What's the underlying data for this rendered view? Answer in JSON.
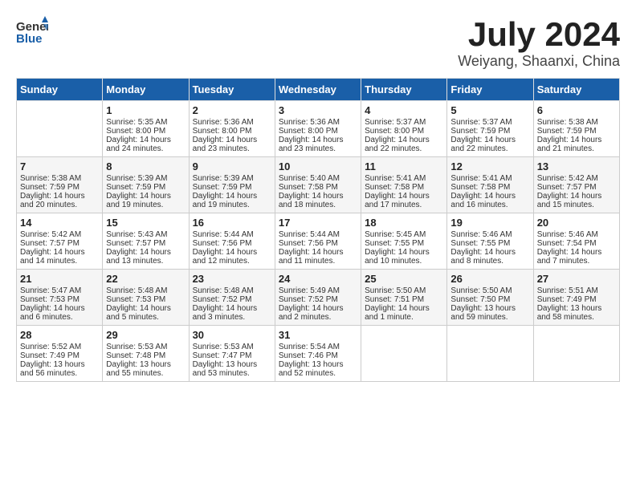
{
  "header": {
    "logo_general": "General",
    "logo_blue": "Blue",
    "month": "July 2024",
    "location": "Weiyang, Shaanxi, China"
  },
  "weekdays": [
    "Sunday",
    "Monday",
    "Tuesday",
    "Wednesday",
    "Thursday",
    "Friday",
    "Saturday"
  ],
  "weeks": [
    [
      {
        "day": "",
        "lines": []
      },
      {
        "day": "1",
        "lines": [
          "Sunrise: 5:35 AM",
          "Sunset: 8:00 PM",
          "Daylight: 14 hours",
          "and 24 minutes."
        ]
      },
      {
        "day": "2",
        "lines": [
          "Sunrise: 5:36 AM",
          "Sunset: 8:00 PM",
          "Daylight: 14 hours",
          "and 23 minutes."
        ]
      },
      {
        "day": "3",
        "lines": [
          "Sunrise: 5:36 AM",
          "Sunset: 8:00 PM",
          "Daylight: 14 hours",
          "and 23 minutes."
        ]
      },
      {
        "day": "4",
        "lines": [
          "Sunrise: 5:37 AM",
          "Sunset: 8:00 PM",
          "Daylight: 14 hours",
          "and 22 minutes."
        ]
      },
      {
        "day": "5",
        "lines": [
          "Sunrise: 5:37 AM",
          "Sunset: 7:59 PM",
          "Daylight: 14 hours",
          "and 22 minutes."
        ]
      },
      {
        "day": "6",
        "lines": [
          "Sunrise: 5:38 AM",
          "Sunset: 7:59 PM",
          "Daylight: 14 hours",
          "and 21 minutes."
        ]
      }
    ],
    [
      {
        "day": "7",
        "lines": [
          "Sunrise: 5:38 AM",
          "Sunset: 7:59 PM",
          "Daylight: 14 hours",
          "and 20 minutes."
        ]
      },
      {
        "day": "8",
        "lines": [
          "Sunrise: 5:39 AM",
          "Sunset: 7:59 PM",
          "Daylight: 14 hours",
          "and 19 minutes."
        ]
      },
      {
        "day": "9",
        "lines": [
          "Sunrise: 5:39 AM",
          "Sunset: 7:59 PM",
          "Daylight: 14 hours",
          "and 19 minutes."
        ]
      },
      {
        "day": "10",
        "lines": [
          "Sunrise: 5:40 AM",
          "Sunset: 7:58 PM",
          "Daylight: 14 hours",
          "and 18 minutes."
        ]
      },
      {
        "day": "11",
        "lines": [
          "Sunrise: 5:41 AM",
          "Sunset: 7:58 PM",
          "Daylight: 14 hours",
          "and 17 minutes."
        ]
      },
      {
        "day": "12",
        "lines": [
          "Sunrise: 5:41 AM",
          "Sunset: 7:58 PM",
          "Daylight: 14 hours",
          "and 16 minutes."
        ]
      },
      {
        "day": "13",
        "lines": [
          "Sunrise: 5:42 AM",
          "Sunset: 7:57 PM",
          "Daylight: 14 hours",
          "and 15 minutes."
        ]
      }
    ],
    [
      {
        "day": "14",
        "lines": [
          "Sunrise: 5:42 AM",
          "Sunset: 7:57 PM",
          "Daylight: 14 hours",
          "and 14 minutes."
        ]
      },
      {
        "day": "15",
        "lines": [
          "Sunrise: 5:43 AM",
          "Sunset: 7:57 PM",
          "Daylight: 14 hours",
          "and 13 minutes."
        ]
      },
      {
        "day": "16",
        "lines": [
          "Sunrise: 5:44 AM",
          "Sunset: 7:56 PM",
          "Daylight: 14 hours",
          "and 12 minutes."
        ]
      },
      {
        "day": "17",
        "lines": [
          "Sunrise: 5:44 AM",
          "Sunset: 7:56 PM",
          "Daylight: 14 hours",
          "and 11 minutes."
        ]
      },
      {
        "day": "18",
        "lines": [
          "Sunrise: 5:45 AM",
          "Sunset: 7:55 PM",
          "Daylight: 14 hours",
          "and 10 minutes."
        ]
      },
      {
        "day": "19",
        "lines": [
          "Sunrise: 5:46 AM",
          "Sunset: 7:55 PM",
          "Daylight: 14 hours",
          "and 8 minutes."
        ]
      },
      {
        "day": "20",
        "lines": [
          "Sunrise: 5:46 AM",
          "Sunset: 7:54 PM",
          "Daylight: 14 hours",
          "and 7 minutes."
        ]
      }
    ],
    [
      {
        "day": "21",
        "lines": [
          "Sunrise: 5:47 AM",
          "Sunset: 7:53 PM",
          "Daylight: 14 hours",
          "and 6 minutes."
        ]
      },
      {
        "day": "22",
        "lines": [
          "Sunrise: 5:48 AM",
          "Sunset: 7:53 PM",
          "Daylight: 14 hours",
          "and 5 minutes."
        ]
      },
      {
        "day": "23",
        "lines": [
          "Sunrise: 5:48 AM",
          "Sunset: 7:52 PM",
          "Daylight: 14 hours",
          "and 3 minutes."
        ]
      },
      {
        "day": "24",
        "lines": [
          "Sunrise: 5:49 AM",
          "Sunset: 7:52 PM",
          "Daylight: 14 hours",
          "and 2 minutes."
        ]
      },
      {
        "day": "25",
        "lines": [
          "Sunrise: 5:50 AM",
          "Sunset: 7:51 PM",
          "Daylight: 14 hours",
          "and 1 minute."
        ]
      },
      {
        "day": "26",
        "lines": [
          "Sunrise: 5:50 AM",
          "Sunset: 7:50 PM",
          "Daylight: 13 hours",
          "and 59 minutes."
        ]
      },
      {
        "day": "27",
        "lines": [
          "Sunrise: 5:51 AM",
          "Sunset: 7:49 PM",
          "Daylight: 13 hours",
          "and 58 minutes."
        ]
      }
    ],
    [
      {
        "day": "28",
        "lines": [
          "Sunrise: 5:52 AM",
          "Sunset: 7:49 PM",
          "Daylight: 13 hours",
          "and 56 minutes."
        ]
      },
      {
        "day": "29",
        "lines": [
          "Sunrise: 5:53 AM",
          "Sunset: 7:48 PM",
          "Daylight: 13 hours",
          "and 55 minutes."
        ]
      },
      {
        "day": "30",
        "lines": [
          "Sunrise: 5:53 AM",
          "Sunset: 7:47 PM",
          "Daylight: 13 hours",
          "and 53 minutes."
        ]
      },
      {
        "day": "31",
        "lines": [
          "Sunrise: 5:54 AM",
          "Sunset: 7:46 PM",
          "Daylight: 13 hours",
          "and 52 minutes."
        ]
      },
      {
        "day": "",
        "lines": []
      },
      {
        "day": "",
        "lines": []
      },
      {
        "day": "",
        "lines": []
      }
    ]
  ]
}
